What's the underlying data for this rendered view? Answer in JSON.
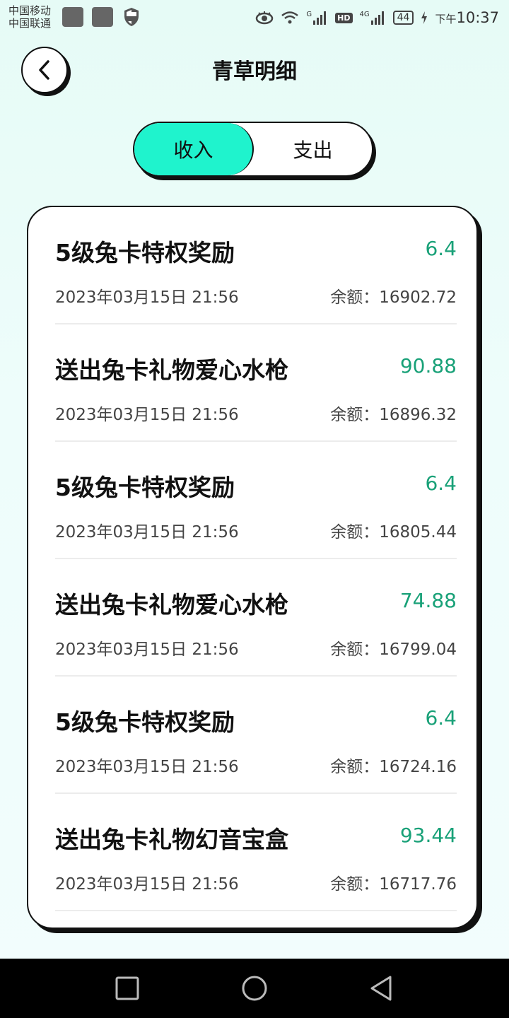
{
  "status_bar": {
    "carrier_1": "中国移动",
    "carrier_2": "中国联通",
    "battery": "44",
    "time_prefix": "下午",
    "time": "10:37",
    "signal_1_label": "G",
    "signal_2_label": "4G",
    "hd_label": "HD"
  },
  "header": {
    "title": "青草明细",
    "back_icon": "chevron-left-icon"
  },
  "tabs": [
    {
      "label": "收入",
      "active": true
    },
    {
      "label": "支出",
      "active": false
    }
  ],
  "records": [
    {
      "title": "5级兔卡特权奖励",
      "amount": "6.4",
      "time": "2023年03月15日 21:56",
      "balance": "余额：16902.72"
    },
    {
      "title": "送出兔卡礼物爱心水枪",
      "amount": "90.88",
      "time": "2023年03月15日 21:56",
      "balance": "余额：16896.32"
    },
    {
      "title": "5级兔卡特权奖励",
      "amount": "6.4",
      "time": "2023年03月15日 21:56",
      "balance": "余额：16805.44"
    },
    {
      "title": "送出兔卡礼物爱心水枪",
      "amount": "74.88",
      "time": "2023年03月15日 21:56",
      "balance": "余额：16799.04"
    },
    {
      "title": "5级兔卡特权奖励",
      "amount": "6.4",
      "time": "2023年03月15日 21:56",
      "balance": "余额：16724.16"
    },
    {
      "title": "送出兔卡礼物幻音宝盒",
      "amount": "93.44",
      "time": "2023年03月15日 21:56",
      "balance": "余额：16717.76"
    }
  ],
  "colors": {
    "accent": "#1ff3cd",
    "amount": "#19a178",
    "background": "#e9fcf8"
  },
  "nav": {
    "recent_icon": "square-icon",
    "home_icon": "circle-icon",
    "back_icon": "triangle-back-icon"
  }
}
